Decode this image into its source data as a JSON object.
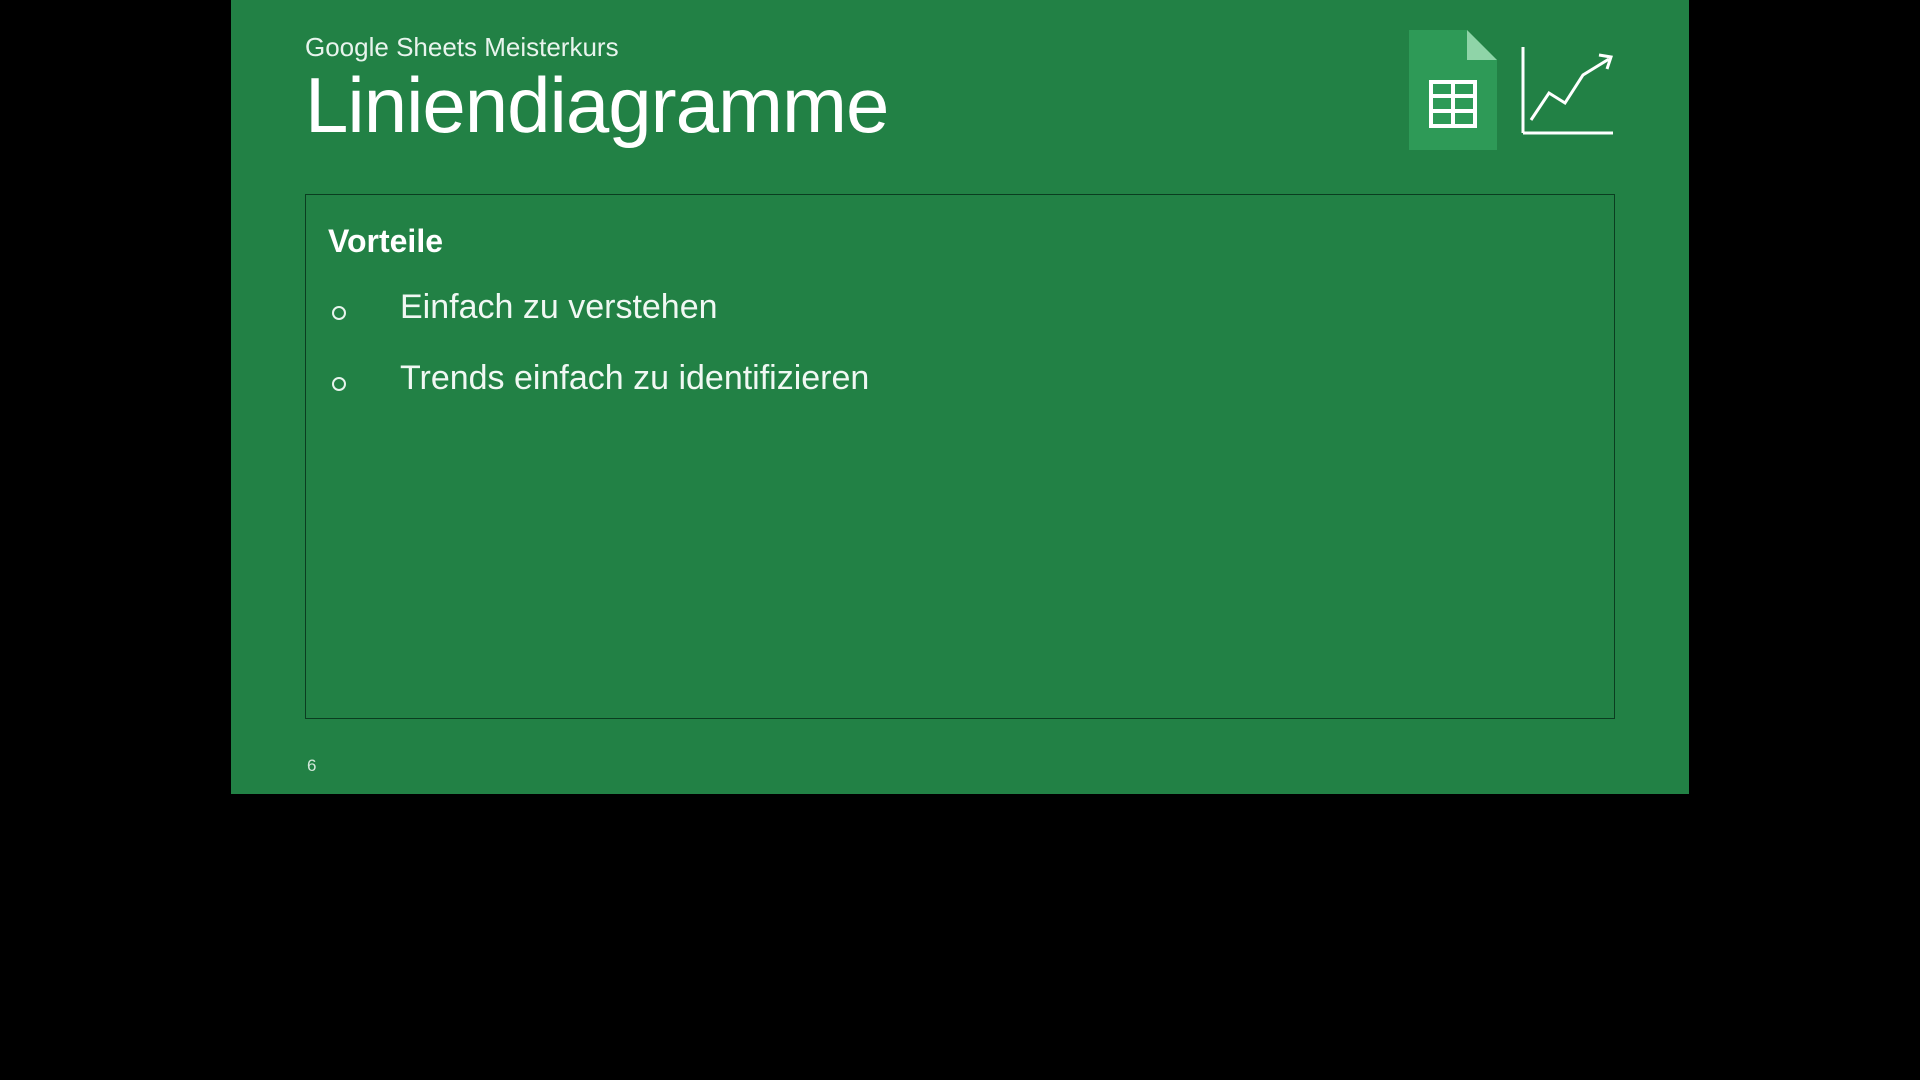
{
  "header": {
    "subtitle": "Google Sheets Meisterkurs",
    "title": "Liniendiagramme"
  },
  "content": {
    "box_title": "Vorteile",
    "bullets": [
      "Einfach zu verstehen",
      "Trends einfach zu identifizieren"
    ]
  },
  "page_number": "6",
  "colors": {
    "background": "#228145",
    "border": "#0a3d20",
    "text": "#ffffff",
    "accent": "#359556"
  }
}
